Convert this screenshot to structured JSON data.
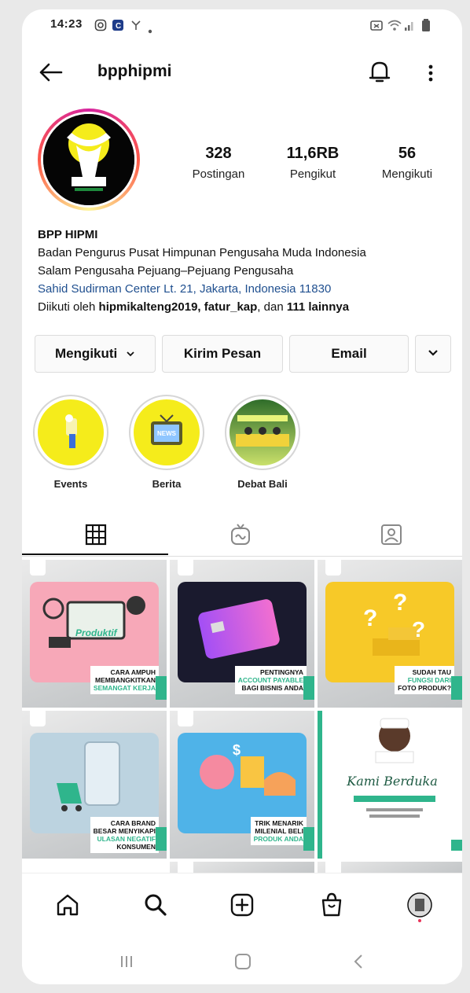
{
  "status_bar": {
    "time": "14:23",
    "icons": [
      "instagram-icon",
      "app-icon",
      "notification-icon",
      "dot-icon",
      "alarm-icon",
      "wifi-icon",
      "signal-icon",
      "battery-icon"
    ]
  },
  "header": {
    "username": "bpphipmi",
    "icons": [
      "back-arrow-icon",
      "bell-icon",
      "more-vertical-icon"
    ]
  },
  "profile": {
    "stats": [
      {
        "value": "328",
        "label": "Postingan"
      },
      {
        "value": "11,6RB",
        "label": "Pengikut"
      },
      {
        "value": "56",
        "label": "Mengikuti"
      }
    ],
    "bio": {
      "name": "BPP HIPMI",
      "line1": "Badan Pengurus Pusat Himpunan Pengusaha Muda Indonesia",
      "line2": "Salam Pengusaha Pejuang–Pejuang Pengusaha",
      "location": "Sahid Sudirman Center Lt. 21, Jakarta, Indonesia 11830",
      "followed_prefix": "Diikuti oleh",
      "followed_names": "hipmikalteng2019, fatur_kap",
      "followed_and": ", dan",
      "followed_others": "111 lainnya"
    }
  },
  "actions": {
    "following": "Mengikuti",
    "message": "Kirim Pesan",
    "email": "Email"
  },
  "highlights": [
    {
      "label": "Events"
    },
    {
      "label": "Berita"
    },
    {
      "label": "Debat Bali"
    }
  ],
  "posts": [
    {
      "caption_l1": "CARA AMPUH",
      "caption_l2": "MEMBANGKITKAN",
      "caption_l3": "SEMANGAT KERJA",
      "badge": "Produktif"
    },
    {
      "caption_l1": "PENTINGNYA",
      "caption_l2": "ACCOUNT PAYABLE",
      "caption_l3": "BAGI BISNIS ANDA"
    },
    {
      "caption_l1": "SUDAH TAU",
      "caption_l2": "FUNGSI DARI",
      "caption_l3": "FOTO PRODUK?"
    },
    {
      "caption_l1": "CARA BRAND",
      "caption_l2": "BESAR MENYIKAPI",
      "caption_l3": "ULASAN NEGATIF",
      "caption_l4": "KONSUMEN"
    },
    {
      "caption_l1": "TRIK MENARIK",
      "caption_l2": "MILENIAL BELI",
      "caption_l3": "PRODUK ANDA"
    },
    {
      "caption_l1": "Kami Berduka"
    }
  ],
  "colors": {
    "accent_green": "#2fb58c",
    "location_blue": "#1f4f8f",
    "highlight_yellow": "#f5ec1b"
  }
}
